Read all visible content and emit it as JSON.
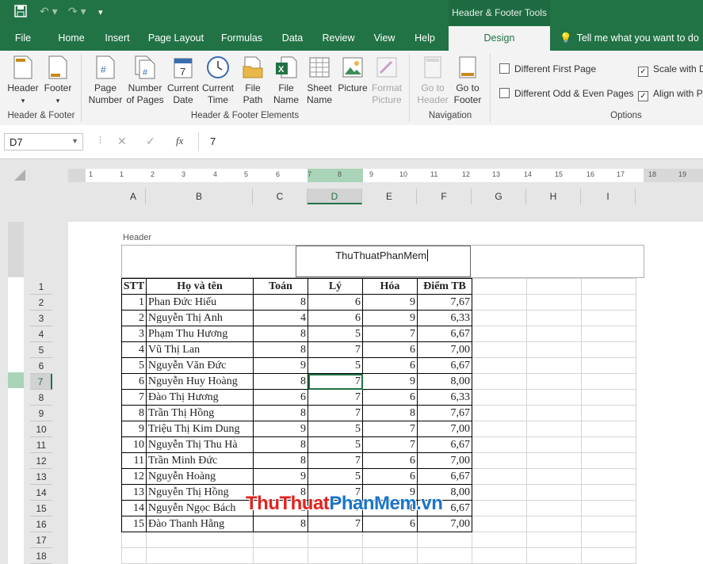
{
  "titlebar": {
    "context_tab": "Header & Footer Tools"
  },
  "tabs": [
    {
      "label": "File"
    },
    {
      "label": "Home"
    },
    {
      "label": "Insert"
    },
    {
      "label": "Page Layout"
    },
    {
      "label": "Formulas"
    },
    {
      "label": "Data"
    },
    {
      "label": "Review"
    },
    {
      "label": "View"
    },
    {
      "label": "Help"
    },
    {
      "label": "Design"
    }
  ],
  "tell_me": "Tell me what you want to do",
  "ribbon": {
    "hf_group": {
      "header": "Header",
      "footer": "Footer",
      "label": "Header & Footer"
    },
    "elements": [
      {
        "l1": "Page",
        "l2": "Number"
      },
      {
        "l1": "Number",
        "l2": "of Pages"
      },
      {
        "l1": "Current",
        "l2": "Date"
      },
      {
        "l1": "Current",
        "l2": "Time"
      },
      {
        "l1": "File",
        "l2": "Path"
      },
      {
        "l1": "File",
        "l2": "Name"
      },
      {
        "l1": "Sheet",
        "l2": "Name"
      },
      {
        "l1": "Picture",
        "l2": ""
      },
      {
        "l1": "Format",
        "l2": "Picture"
      }
    ],
    "elements_label": "Header & Footer Elements",
    "navigation": [
      {
        "l1": "Go to",
        "l2": "Header"
      },
      {
        "l1": "Go to",
        "l2": "Footer"
      }
    ],
    "navigation_label": "Navigation",
    "options": {
      "diff_first": "Different First Page",
      "diff_odd": "Different Odd & Even Pages",
      "scale": "Scale with Document",
      "align": "Align with Page Margins",
      "label": "Options"
    }
  },
  "formula_bar": {
    "name_box": "D7",
    "cancel": "✕",
    "enter": "✓",
    "fx": "fx",
    "value": "7"
  },
  "ruler_marks": [
    "1",
    "1",
    "2",
    "3",
    "4",
    "5",
    "6",
    "7",
    "8",
    "9",
    "10",
    "11",
    "12",
    "13",
    "14",
    "15",
    "16",
    "17",
    "18",
    "19"
  ],
  "columns": [
    "A",
    "B",
    "C",
    "D",
    "E",
    "F",
    "G",
    "H",
    "I"
  ],
  "header_area": {
    "label": "Header",
    "center_text": "ThuThuatPhanMem"
  },
  "row_numbers": [
    "1",
    "2",
    "3",
    "4",
    "5",
    "6",
    "7",
    "8",
    "9",
    "10",
    "11",
    "12",
    "13",
    "14",
    "15",
    "16",
    "17",
    "18"
  ],
  "table": {
    "headers": [
      "STT",
      "Họ và tên",
      "Toán",
      "Lý",
      "Hóa",
      "Điểm TB"
    ],
    "rows": [
      [
        "1",
        "Phan Đức Hiếu",
        "8",
        "6",
        "9",
        "7,67"
      ],
      [
        "2",
        "Nguyễn Thị Anh",
        "4",
        "6",
        "9",
        "6,33"
      ],
      [
        "3",
        "Phạm Thu Hương",
        "8",
        "5",
        "7",
        "6,67"
      ],
      [
        "4",
        "Vũ Thị Lan",
        "8",
        "7",
        "6",
        "7,00"
      ],
      [
        "5",
        "Nguyễn Văn Đức",
        "9",
        "5",
        "6",
        "6,67"
      ],
      [
        "6",
        "Nguyễn Huy Hoàng",
        "8",
        "7",
        "9",
        "8,00"
      ],
      [
        "7",
        "Đào Thị Hương",
        "6",
        "7",
        "6",
        "6,33"
      ],
      [
        "8",
        "Trần Thị Hồng",
        "8",
        "7",
        "8",
        "7,67"
      ],
      [
        "9",
        "Triệu Thị Kim Dung",
        "9",
        "5",
        "7",
        "7,00"
      ],
      [
        "10",
        "Nguyễn Thị Thu Hà",
        "8",
        "5",
        "7",
        "6,67"
      ],
      [
        "11",
        "Trần Minh Đức",
        "8",
        "7",
        "6",
        "7,00"
      ],
      [
        "12",
        "Nguyễn Hoàng",
        "9",
        "5",
        "6",
        "6,67"
      ],
      [
        "13",
        "Nguyễn Thị Hồng",
        "8",
        "7",
        "9",
        "8,00"
      ],
      [
        "14",
        "Nguyễn Ngọc Bách",
        "8",
        "7",
        "6",
        "6,67"
      ],
      [
        "15",
        "Đào Thanh Hằng",
        "8",
        "7",
        "6",
        "7,00"
      ]
    ]
  },
  "watermark": {
    "part1": "ThuThuat",
    "part2": "PhanMem",
    "part3": ".vn"
  },
  "colors": {
    "accent": "#217346",
    "watermark_red": "#e0231f",
    "watermark_blue": "#1a75c8"
  }
}
